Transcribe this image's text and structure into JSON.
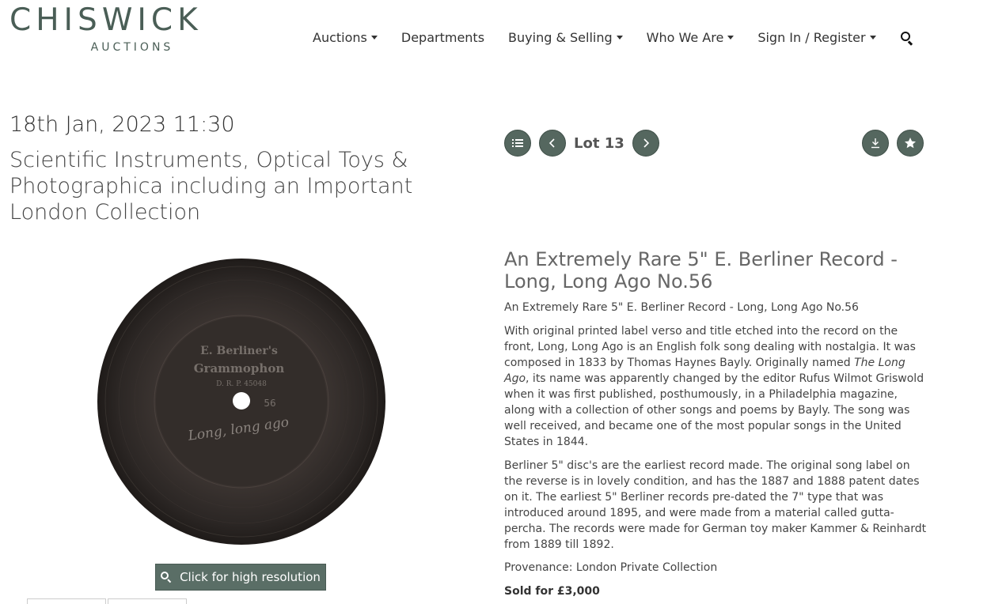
{
  "brand": {
    "name": "CHISWICK",
    "sub": "AUCTIONS"
  },
  "nav": {
    "auctions": "Auctions",
    "departments": "Departments",
    "buying_selling": "Buying & Selling",
    "who_we_are": "Who We Are",
    "sign_in": "Sign In / Register"
  },
  "sale": {
    "date": "18th Jan, 2023 11:30",
    "title": "Scientific Instruments, Optical Toys & Photographica including an Important London Collection"
  },
  "lot_nav": {
    "label": "Lot 13"
  },
  "record_label": {
    "line1": "E. Berliner's",
    "line2": "Grammophon",
    "line3": "D. R. P. 45048",
    "number": "56",
    "signature": "Long, long ago"
  },
  "hires_button": "Click for high resolution",
  "lot": {
    "title": "An Extremely Rare 5\" E. Berliner Record - Long, Long Ago No.56",
    "subtitle": "An Extremely Rare 5\" E. Berliner Record - Long, Long Ago No.56",
    "desc1_a": "With original printed label verso and title etched into the record on the front, Long, Long Ago is an English folk song dealing with nostalgia. It was composed in 1833 by Thomas Haynes Bayly. Originally named ",
    "desc1_italic": "The Long Ago",
    "desc1_b": ", its name was apparently changed by the editor Rufus Wilmot Griswold when it was first published, posthumously, in a Philadelphia magazine, along with a collection of other songs and poems by Bayly. The song was well received, and became one of the most popular songs in the United States in 1844.",
    "desc2": "Berliner 5\" disc's are the earliest record made. The original song label on the reverse is in lovely condition, and has the 1887 and 1888 patent dates on it. The earliest 5\" Berliner records pre-dated the 7\" type that was introduced around 1895, and were made from a material called gutta-percha. The records were made for German toy maker Kammer & Reinhardt from 1889 till 1892.",
    "provenance": "Provenance: London Private Collection",
    "sold": "Sold for £3,000"
  },
  "colors": {
    "accent": "#55675f",
    "logo": "#4a5e56"
  }
}
